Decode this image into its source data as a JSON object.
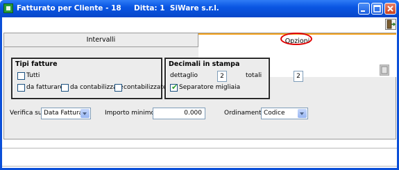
{
  "window": {
    "title": "Fatturato per Cliente - 18     Ditta: 1  SiWare s.r.l."
  },
  "tabs": [
    {
      "label": "Intervalli",
      "active": false
    },
    {
      "label": "Opzioni",
      "active": true
    }
  ],
  "tipi_fatture": {
    "title": "Tipi fatture",
    "options": [
      {
        "label": "Tutti",
        "checked": false
      },
      {
        "label": "da fatturare",
        "checked": false
      },
      {
        "label": "da contabilizzare",
        "checked": false
      },
      {
        "label": "contabilizzate",
        "checked": false
      }
    ]
  },
  "decimali": {
    "title": "Decimali in stampa",
    "dettaglio_label": "dettaglio",
    "dettaglio_value": "2",
    "totali_label": "totali",
    "totali_value": "2",
    "separatore_label": "Separatore migliaia",
    "separatore_checked": true,
    "checkmark": "✔"
  },
  "filters": {
    "verifica_label": "Verifica su",
    "verifica_value": "Data Fattura",
    "importo_label": "Importo minimo",
    "importo_value": "0.000",
    "ordinamento_label": "Ordinamento",
    "ordinamento_value": "Codice"
  },
  "colors": {
    "titlebar": "#0a56e3",
    "tab_highlight": "#f4a21b",
    "annotation_circle": "#e00000",
    "check": "#2c9e2c"
  }
}
